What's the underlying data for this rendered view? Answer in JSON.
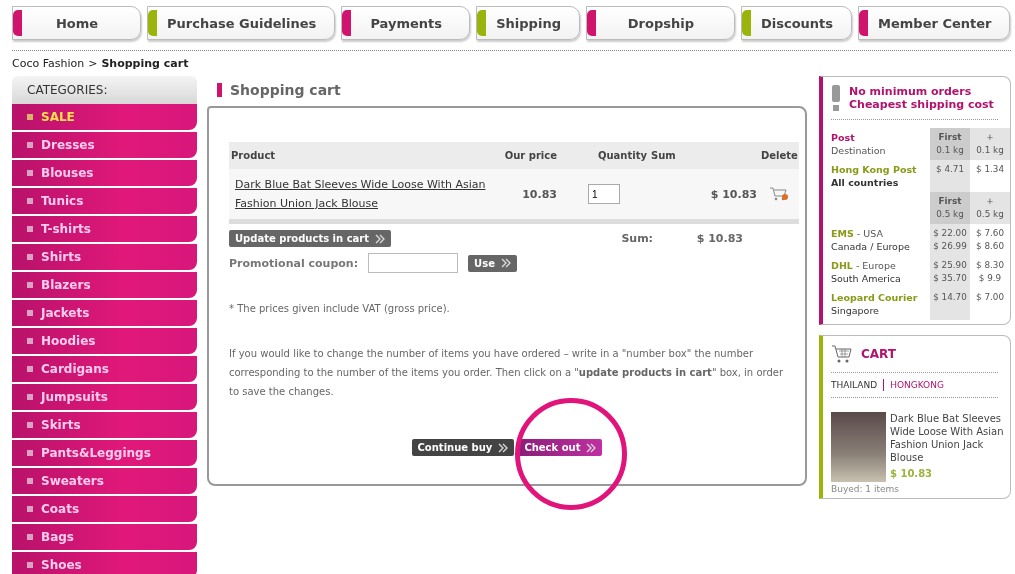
{
  "nav": [
    {
      "label": "Home",
      "color": "#d0146e"
    },
    {
      "label": "Purchase Guidelines",
      "color": "#9ab40c"
    },
    {
      "label": "Payments",
      "color": "#d0146e"
    },
    {
      "label": "Shipping",
      "color": "#9ab40c"
    },
    {
      "label": "Dropship",
      "color": "#d0146e"
    },
    {
      "label": "Discounts",
      "color": "#9ab40c"
    },
    {
      "label": "Member Center",
      "color": "#d0146e"
    }
  ],
  "breadcrumb": {
    "parent": "Coco Fashion",
    "separator": ">",
    "current": "Shopping cart"
  },
  "categories": {
    "title": "CATEGORIES:",
    "items": [
      {
        "label": "SALE",
        "highlighted": true
      },
      {
        "label": "Dresses",
        "highlighted": false
      },
      {
        "label": "Blouses",
        "highlighted": false
      },
      {
        "label": "Tunics",
        "highlighted": false
      },
      {
        "label": "T-shirts",
        "highlighted": false
      },
      {
        "label": "Shirts",
        "highlighted": false
      },
      {
        "label": "Blazers",
        "highlighted": false
      },
      {
        "label": "Jackets",
        "highlighted": false
      },
      {
        "label": "Hoodies",
        "highlighted": false
      },
      {
        "label": "Cardigans",
        "highlighted": false
      },
      {
        "label": "Jumpsuits",
        "highlighted": false
      },
      {
        "label": "Skirts",
        "highlighted": false
      },
      {
        "label": "Pants&Leggings",
        "highlighted": false
      },
      {
        "label": "Sweaters",
        "highlighted": false
      },
      {
        "label": "Coats",
        "highlighted": false
      },
      {
        "label": "Bags",
        "highlighted": false
      },
      {
        "label": "Shoes",
        "highlighted": false
      }
    ]
  },
  "cart": {
    "title": "Shopping cart",
    "columns": [
      "Product",
      "Our price",
      "Quantity",
      "Sum",
      "Delete"
    ],
    "rows": [
      {
        "product": "Dark Blue Bat Sleeves Wide Loose With Asian Fashion Union Jack Blouse",
        "price": "10.83",
        "quantity": "1",
        "sum": "$ 10.83"
      }
    ],
    "update_button": "Update products in cart",
    "sum_label": "Sum:",
    "sum_value": "$ 10.83",
    "coupon": {
      "label": "Promotional coupon:",
      "button": "Use"
    },
    "vat_note": "* The prices given include VAT (gross price).",
    "help": "If you would like to change the number of items you have ordered – write in a \"number box\" the number corresponding to the number of the items you order. Then click on a \"**update products in cart**\" box, in order to save the changes.",
    "continue_button": "Continue buy",
    "checkout_button": "Check out",
    "checkout_highlighted": true
  },
  "shipping": {
    "headline": [
      "No minimum orders",
      "Cheapest shipping cost"
    ],
    "rows": [
      {
        "kind": "header",
        "title": "Post",
        "sub": "Destination",
        "first": [
          "First",
          "0.1 kg"
        ],
        "extra": [
          "+",
          "0.1 kg"
        ]
      },
      {
        "kind": "rate",
        "title": "Hong Kong Post",
        "sub": "All countries",
        "first": [
          "$ 4.71"
        ],
        "extra": [
          "$ 1.34"
        ]
      },
      {
        "kind": "header",
        "first": [
          "First",
          "0.5 kg"
        ],
        "extra": [
          "+",
          "0.5 kg"
        ]
      },
      {
        "kind": "rate",
        "title": "EMS",
        "note": "- USA",
        "sub": "Canada / Europe",
        "first": [
          "$ 22.00",
          "$ 26.99"
        ],
        "extra": [
          "$ 7.60",
          "$ 8.60"
        ]
      },
      {
        "kind": "rate",
        "title": "DHL",
        "note": "- Europe",
        "sub": "South America",
        "first": [
          "$ 25.90",
          "$ 35.70"
        ],
        "extra": [
          "$ 8.30",
          "$ 9.9"
        ]
      },
      {
        "kind": "rate",
        "title": "Leopard Courier",
        "sub": "Singapore",
        "first": [
          "$ 14.70"
        ],
        "extra": [
          "$ 7.00"
        ]
      }
    ]
  },
  "mini_cart": {
    "title": "CART",
    "tabs": [
      {
        "label": "THAILAND",
        "selected": false
      },
      {
        "label": "HONGKONG",
        "selected": true
      }
    ],
    "item": {
      "name": "Dark Blue Bat Sleeves Wide Loose With Asian Fashion Union Jack Blouse",
      "price": "$ 10.83",
      "bought": "Buyed: 1 items"
    }
  }
}
